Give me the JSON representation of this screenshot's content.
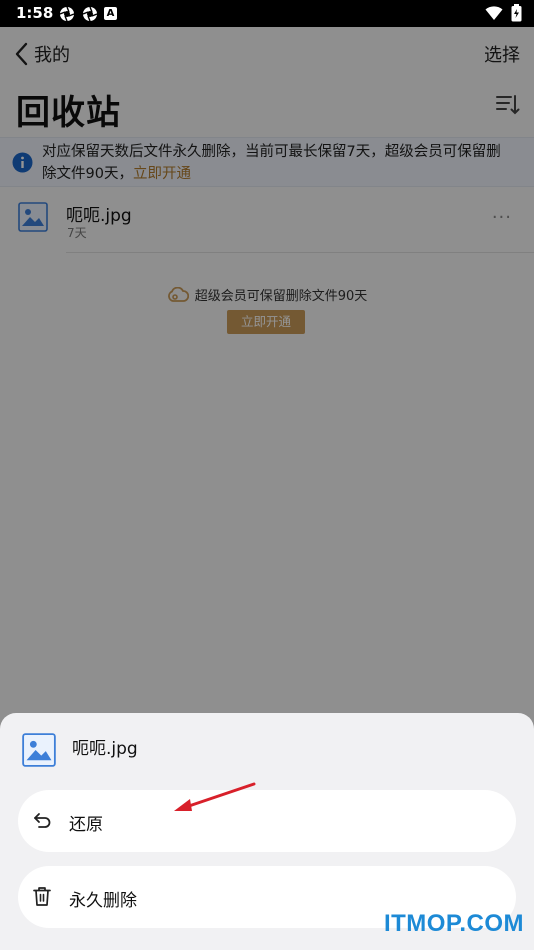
{
  "status_bar": {
    "time": "1:58",
    "badge": "A"
  },
  "header": {
    "back_label": "我的",
    "select_label": "选择",
    "title": "回收站"
  },
  "notice": {
    "text": "对应保留天数后文件永久删除，当前可最长保留7天，超级会员可保留删",
    "text2": "除文件90天，",
    "link": "立即开通"
  },
  "file": {
    "name": "呃呃.jpg",
    "days": "7天",
    "more": "···"
  },
  "promo": {
    "text": "超级会员可保留删除文件90天",
    "button": "立即开通"
  },
  "sheet": {
    "file_name": "呃呃.jpg",
    "actions": [
      {
        "label": "还原",
        "icon": "undo-icon"
      },
      {
        "label": "永久删除",
        "icon": "trash-icon"
      }
    ]
  },
  "watermark": "ITMOP.COM",
  "colors": {
    "accent_gold": "#c89a58",
    "link": "#b07a2c",
    "info_blue": "#1a66c9",
    "arrow_red": "#d8202a",
    "watermark_blue": "#1d8ad6"
  }
}
